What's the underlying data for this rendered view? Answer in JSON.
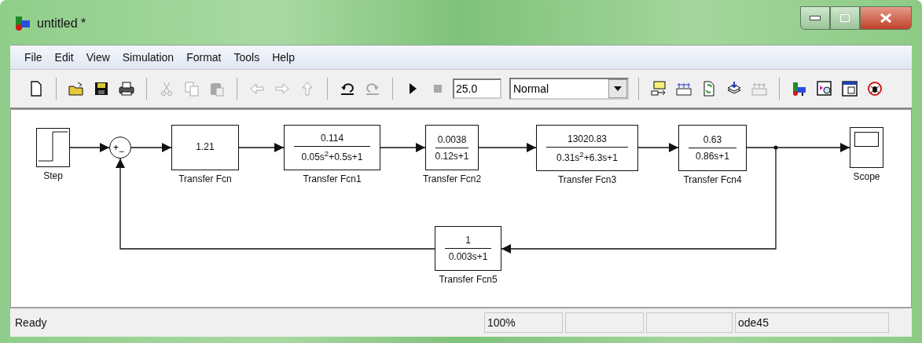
{
  "window": {
    "title": "untitled *"
  },
  "menu": [
    "File",
    "Edit",
    "View",
    "Simulation",
    "Format",
    "Tools",
    "Help"
  ],
  "toolbar": {
    "items": [
      {
        "kind": "new",
        "disabled": false
      },
      {
        "kind": "separator"
      },
      {
        "kind": "open",
        "disabled": false
      },
      {
        "kind": "save",
        "disabled": false
      },
      {
        "kind": "print",
        "disabled": false
      },
      {
        "kind": "separator"
      },
      {
        "kind": "cut",
        "disabled": true
      },
      {
        "kind": "copy",
        "disabled": true
      },
      {
        "kind": "paste",
        "disabled": true
      },
      {
        "kind": "separator"
      },
      {
        "kind": "back",
        "disabled": true
      },
      {
        "kind": "forward",
        "disabled": true
      },
      {
        "kind": "up",
        "disabled": true
      },
      {
        "kind": "separator"
      },
      {
        "kind": "undo",
        "disabled": false
      },
      {
        "kind": "redo",
        "disabled": true
      },
      {
        "kind": "separator"
      },
      {
        "kind": "play",
        "disabled": false
      },
      {
        "kind": "stop",
        "disabled": true
      },
      {
        "kind": "field",
        "value": "25.0"
      },
      {
        "kind": "dropdown",
        "value": "Normal"
      },
      {
        "kind": "separator"
      },
      {
        "kind": "update",
        "disabled": false
      },
      {
        "kind": "build",
        "disabled": false
      },
      {
        "kind": "refresh",
        "disabled": false
      },
      {
        "kind": "stack",
        "disabled": false
      },
      {
        "kind": "build",
        "disabled": true
      },
      {
        "kind": "separator"
      },
      {
        "kind": "library",
        "disabled": false
      },
      {
        "kind": "explorer",
        "disabled": false
      },
      {
        "kind": "window",
        "disabled": false
      },
      {
        "kind": "debug",
        "disabled": false
      }
    ]
  },
  "diagram": {
    "blocks": [
      {
        "kind": "step",
        "label": "Step"
      },
      {
        "kind": "sum",
        "signs": [
          "+",
          "−"
        ]
      },
      {
        "kind": "transfer",
        "label": "Transfer Fcn",
        "numerator": "1.21"
      },
      {
        "kind": "transfer",
        "label": "Transfer Fcn1",
        "numerator": "0.114",
        "denominator": "0.05s$^{2}$+0.5s+1"
      },
      {
        "kind": "transfer",
        "label": "Transfer Fcn2",
        "numerator": "0.0038",
        "denominator": "0.12s+1"
      },
      {
        "kind": "transfer",
        "label": "Transfer Fcn3",
        "numerator": "13020.83",
        "denominator": "0.31s$^{2}$+6.3s+1"
      },
      {
        "kind": "transfer",
        "label": "Transfer Fcn4",
        "numerator": "0.63",
        "denominator": "0.86s+1"
      },
      {
        "kind": "scope",
        "label": "Scope"
      },
      {
        "kind": "transfer",
        "label": "Transfer Fcn5",
        "numerator": "1",
        "denominator": "0.003s+1"
      }
    ]
  },
  "status_bar": {
    "message": "Ready",
    "zoom": "100%",
    "solver": "ode45"
  }
}
